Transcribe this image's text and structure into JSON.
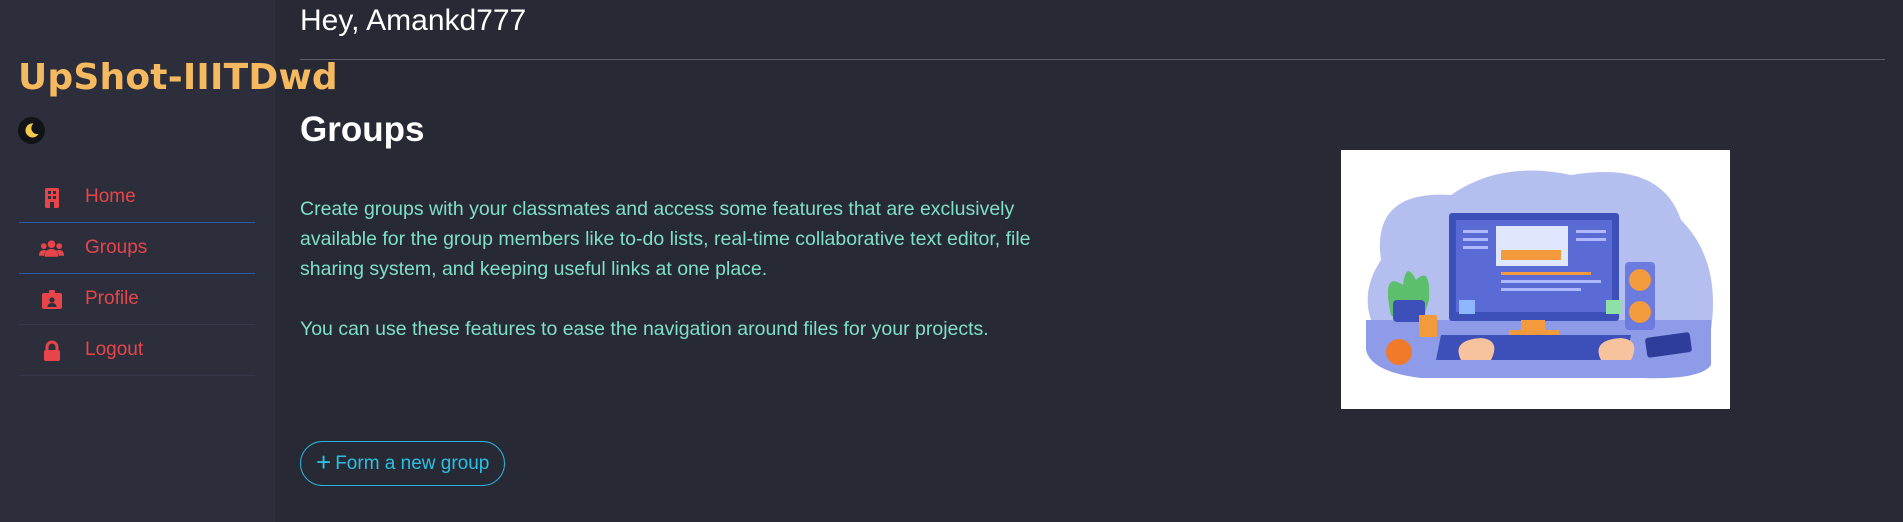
{
  "brand": "UpShot-IIITDwd",
  "theme_toggle_icon": "moon-icon",
  "sidebar": {
    "items": [
      {
        "label": "Home",
        "icon": "building-icon"
      },
      {
        "label": "Groups",
        "icon": "users-icon"
      },
      {
        "label": "Profile",
        "icon": "id-badge-icon"
      },
      {
        "label": "Logout",
        "icon": "lock-icon"
      }
    ]
  },
  "header": {
    "greeting": "Hey, Amankd777"
  },
  "main": {
    "title": "Groups",
    "paragraph1": "Create groups with your classmates and access some features that are exclusively available for the group members like to-do lists, real-time collaborative text editor, file sharing system, and keeping useful links at one place.",
    "paragraph2": "You can use these features to ease the navigation around files for your projects.",
    "form_button_icon": "+",
    "form_button_label": "Form a new group"
  },
  "colors": {
    "brand": "#f5b960",
    "nav_text": "#e8454a",
    "description_text": "#7fe0c6",
    "button_accent": "#29c0e3",
    "background": "#272a35",
    "sidebar": "#2c2f3b"
  }
}
